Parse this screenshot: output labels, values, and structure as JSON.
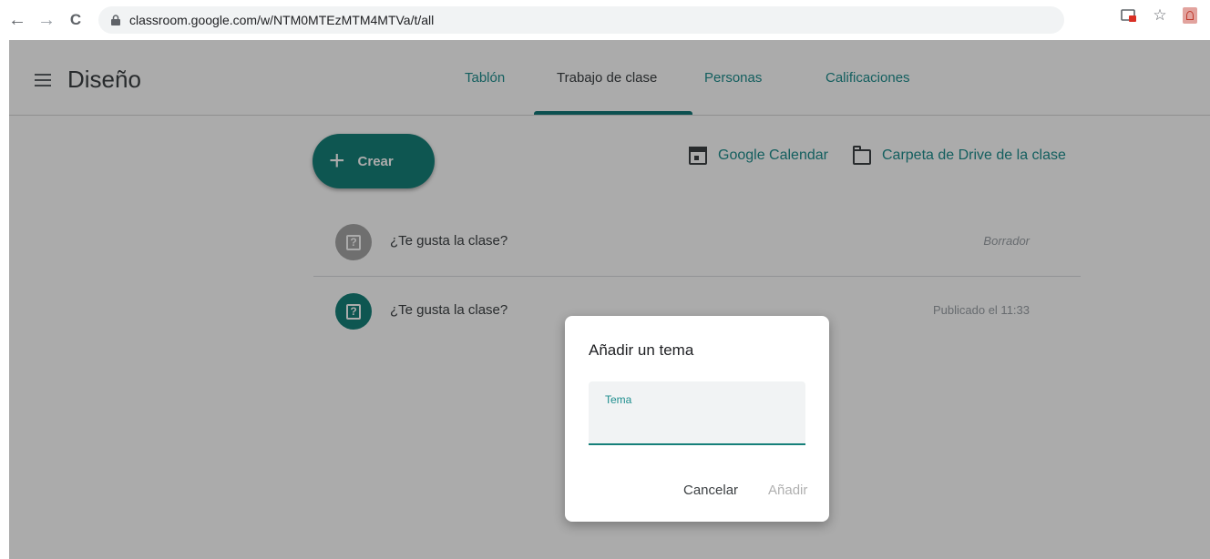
{
  "browser": {
    "url": "classroom.google.com/w/NTM0MTEzMTM4MTVa/t/all",
    "back_glyph": "←",
    "forward_glyph": "→",
    "reload_glyph": "C",
    "star_glyph": "☆"
  },
  "header": {
    "class_title": "Diseño",
    "tabs": [
      {
        "label": "Tablón",
        "active": false
      },
      {
        "label": "Trabajo de clase",
        "active": true
      },
      {
        "label": "Personas",
        "active": false
      },
      {
        "label": "Calificaciones",
        "active": false
      }
    ]
  },
  "toolbar": {
    "create_plus": "+",
    "create_label": "Crear",
    "calendar_label": "Google Calendar",
    "drive_label": "Carpeta de Drive de la clase"
  },
  "items": [
    {
      "title": "¿Te gusta la clase?",
      "status": "Borrador",
      "icon": "question-icon"
    },
    {
      "title": "¿Te gusta la clase?",
      "status": "Publicado el 11:33",
      "icon": "question-icon"
    }
  ],
  "question_glyph": "?",
  "dialog": {
    "title": "Añadir un tema",
    "field_label": "Tema",
    "field_value": "",
    "cancel_label": "Cancelar",
    "add_label": "Añadir"
  },
  "colors": {
    "accent": "#16807a",
    "tab_text": "#1e8e8e",
    "disabled": "#b0b0b0"
  }
}
